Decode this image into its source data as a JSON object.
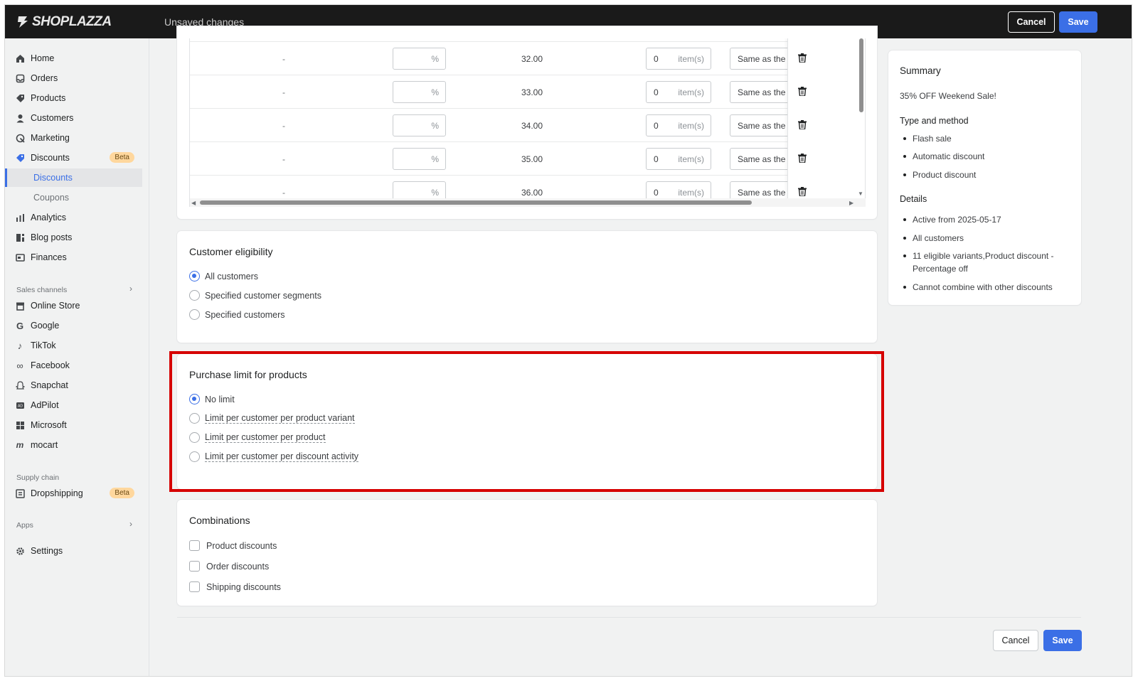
{
  "topbar": {
    "logo_text": "SHOPLAZZA",
    "status": "Unsaved changes",
    "cancel_label": "Cancel",
    "save_label": "Save"
  },
  "sidebar": {
    "items": [
      {
        "label": "Home",
        "icon": "home-icon"
      },
      {
        "label": "Orders",
        "icon": "orders-icon"
      },
      {
        "label": "Products",
        "icon": "tag-icon"
      },
      {
        "label": "Customers",
        "icon": "person-icon"
      },
      {
        "label": "Marketing",
        "icon": "marketing-icon"
      },
      {
        "label": "Discounts",
        "icon": "discount-icon",
        "badge": "Beta"
      },
      {
        "label": "Discounts",
        "sub": true,
        "active": true
      },
      {
        "label": "Coupons",
        "sub": true
      },
      {
        "label": "Analytics",
        "icon": "bar-chart-icon"
      },
      {
        "label": "Blog posts",
        "icon": "blog-icon"
      },
      {
        "label": "Finances",
        "icon": "finance-icon"
      }
    ],
    "sales_channels_label": "Sales channels",
    "channels": [
      {
        "label": "Online Store",
        "icon": "store-icon"
      },
      {
        "label": "Google",
        "icon": "google-icon"
      },
      {
        "label": "TikTok",
        "icon": "tiktok-icon"
      },
      {
        "label": "Facebook",
        "icon": "meta-icon"
      },
      {
        "label": "Snapchat",
        "icon": "snapchat-icon"
      },
      {
        "label": "AdPilot",
        "icon": "adpilot-icon"
      },
      {
        "label": "Microsoft",
        "icon": "microsoft-icon"
      },
      {
        "label": "mocart",
        "icon": "mocart-icon"
      }
    ],
    "supply_chain_label": "Supply chain",
    "dropshipping": {
      "label": "Dropshipping",
      "badge": "Beta"
    },
    "apps_label": "Apps",
    "settings_label": "Settings"
  },
  "variants_table": {
    "rows": [
      {
        "dash": "-",
        "pct_unit": "%",
        "price": "32.00",
        "qty": "0",
        "qty_unit": "item(s)",
        "limit": "Same as the product"
      },
      {
        "dash": "-",
        "pct_unit": "%",
        "price": "33.00",
        "qty": "0",
        "qty_unit": "item(s)",
        "limit": "Same as the product"
      },
      {
        "dash": "-",
        "pct_unit": "%",
        "price": "34.00",
        "qty": "0",
        "qty_unit": "item(s)",
        "limit": "Same as the product"
      },
      {
        "dash": "-",
        "pct_unit": "%",
        "price": "35.00",
        "qty": "0",
        "qty_unit": "item(s)",
        "limit": "Same as the product"
      },
      {
        "dash": "-",
        "pct_unit": "%",
        "price": "36.00",
        "qty": "0",
        "qty_unit": "item(s)",
        "limit": "Same as the product"
      }
    ]
  },
  "customer_eligibility": {
    "title": "Customer eligibility",
    "options": [
      "All customers",
      "Specified customer segments",
      "Specified customers"
    ],
    "selected_index": 0
  },
  "purchase_limit": {
    "title": "Purchase limit for products",
    "options": [
      "No limit",
      "Limit per customer per product variant",
      "Limit per customer per product",
      "Limit per customer per discount activity"
    ],
    "selected_index": 0
  },
  "combinations": {
    "title": "Combinations",
    "options": [
      "Product discounts",
      "Order discounts",
      "Shipping discounts"
    ]
  },
  "summary": {
    "title": "Summary",
    "name": "35% OFF Weekend Sale!",
    "type_heading": "Type and method",
    "type_items": [
      "Flash sale",
      "Automatic discount",
      "Product discount"
    ],
    "details_heading": "Details",
    "details_items": [
      "Active from 2025-05-17",
      "All customers",
      "11 eligible variants,Product discount - Percentage off",
      "Cannot combine with other discounts"
    ]
  },
  "footer": {
    "cancel_label": "Cancel",
    "save_label": "Save"
  },
  "colors": {
    "accent": "#3b6fe6",
    "highlight": "#d60000",
    "topbar": "#1a1a1a",
    "badge": "#ffd79d"
  }
}
